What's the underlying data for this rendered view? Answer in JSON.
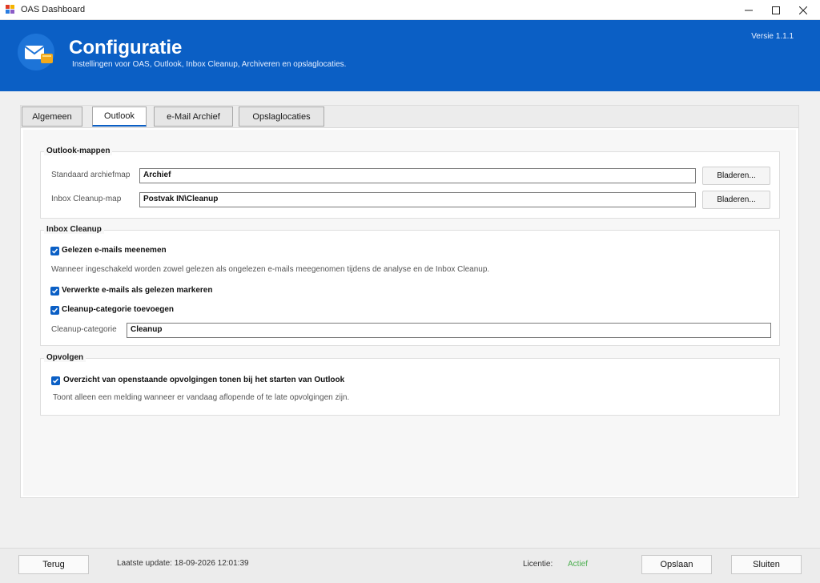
{
  "window": {
    "title": "OAS Dashboard",
    "icon": "app-icon"
  },
  "header": {
    "title": "Configuratie",
    "subtitle": "Instellingen voor OAS, Outlook, Inbox Cleanup, Archiveren en opslaglocaties.",
    "version": "Versie 1.1.1",
    "accent": "#0b5fc5"
  },
  "tabs": [
    {
      "label": "Algemeen",
      "active": false
    },
    {
      "label": "Outlook",
      "active": true
    },
    {
      "label": "e-Mail Archief",
      "active": false
    },
    {
      "label": "Opslaglocaties",
      "active": false
    }
  ],
  "groups": {
    "outlook_mappen": {
      "title": "Outlook-mappen",
      "archief_label": "Standaard archiefmap",
      "archief_value": "Archief",
      "cleanup_label": "Inbox Cleanup-map",
      "cleanup_value": "Postvak IN\\Cleanup",
      "browse_label": "Bladeren..."
    },
    "inbox_cleanup": {
      "title": "Inbox Cleanup",
      "chk_gelezen": "Gelezen e-mails meenemen",
      "gelezen_desc": "Wanneer ingeschakeld worden zowel gelezen als ongelezen e-mails meegenomen tijdens de analyse en de Inbox Cleanup.",
      "chk_markeren": "Verwerkte e-mails als gelezen markeren",
      "chk_categorie": "Cleanup-categorie toevoegen",
      "categorie_label": "Cleanup-categorie",
      "categorie_value": "Cleanup"
    },
    "opvolgen": {
      "title": "Opvolgen",
      "chk_overzicht": "Overzicht van openstaande opvolgingen tonen bij het starten van Outlook",
      "overzicht_desc": "Toont alleen een melding wanneer er vandaag aflopende of te late opvolgingen zijn."
    }
  },
  "footer": {
    "back_label": "Terug",
    "last_update": "Laatste update: 18-09-2026 12:01:39",
    "license_label": "Licentie:",
    "license_value": "Actief",
    "save_label": "Opslaan",
    "close_label": "Sluiten",
    "status_color": "#4caf50"
  }
}
